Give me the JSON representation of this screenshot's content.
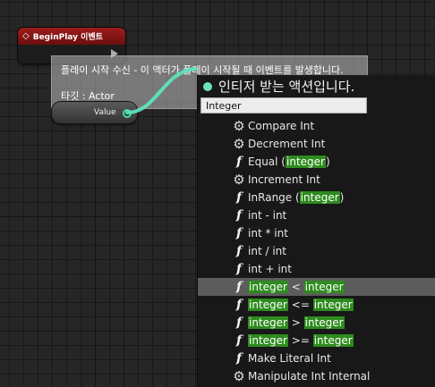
{
  "event_node": {
    "title": "BeginPlay 이벤트"
  },
  "tooltip": {
    "description": "플레이 시작 수신 - 이 액터가 플레이 시작될 때 이벤트를 발생합니다.",
    "target": "타깃 : Actor"
  },
  "value_node": {
    "label": "Value"
  },
  "action_menu": {
    "title": "인티저 받는 액션입니다.",
    "search_value": "Integer",
    "highlight_color": "#2e8b1e",
    "items": [
      {
        "icon": "gear",
        "parts": [
          {
            "t": "Compare Int"
          }
        ]
      },
      {
        "icon": "gear",
        "parts": [
          {
            "t": "Decrement Int"
          }
        ]
      },
      {
        "icon": "function",
        "parts": [
          {
            "t": "Equal ("
          },
          {
            "t": "integer",
            "hl": true
          },
          {
            "t": ")"
          }
        ]
      },
      {
        "icon": "gear",
        "parts": [
          {
            "t": "Increment Int"
          }
        ]
      },
      {
        "icon": "function",
        "parts": [
          {
            "t": "InRange ("
          },
          {
            "t": "integer",
            "hl": true
          },
          {
            "t": ")"
          }
        ]
      },
      {
        "icon": "function",
        "parts": [
          {
            "t": "int - int"
          }
        ]
      },
      {
        "icon": "function",
        "parts": [
          {
            "t": "int * int"
          }
        ]
      },
      {
        "icon": "function",
        "parts": [
          {
            "t": "int / int"
          }
        ]
      },
      {
        "icon": "function",
        "parts": [
          {
            "t": "int + int"
          }
        ]
      },
      {
        "icon": "function",
        "selected": true,
        "parts": [
          {
            "t": "integer",
            "hl": true
          },
          {
            "t": " < "
          },
          {
            "t": "integer",
            "hl": true
          }
        ]
      },
      {
        "icon": "function",
        "parts": [
          {
            "t": "integer",
            "hl": true
          },
          {
            "t": " <= "
          },
          {
            "t": "integer",
            "hl": true
          }
        ]
      },
      {
        "icon": "function",
        "parts": [
          {
            "t": "integer",
            "hl": true
          },
          {
            "t": " > "
          },
          {
            "t": "integer",
            "hl": true
          }
        ]
      },
      {
        "icon": "function",
        "parts": [
          {
            "t": "integer",
            "hl": true
          },
          {
            "t": " >= "
          },
          {
            "t": "integer",
            "hl": true
          }
        ]
      },
      {
        "icon": "function",
        "parts": [
          {
            "t": "Make Literal Int"
          }
        ]
      },
      {
        "icon": "gear",
        "parts": [
          {
            "t": "Manipulate Int Internal"
          }
        ]
      }
    ]
  }
}
